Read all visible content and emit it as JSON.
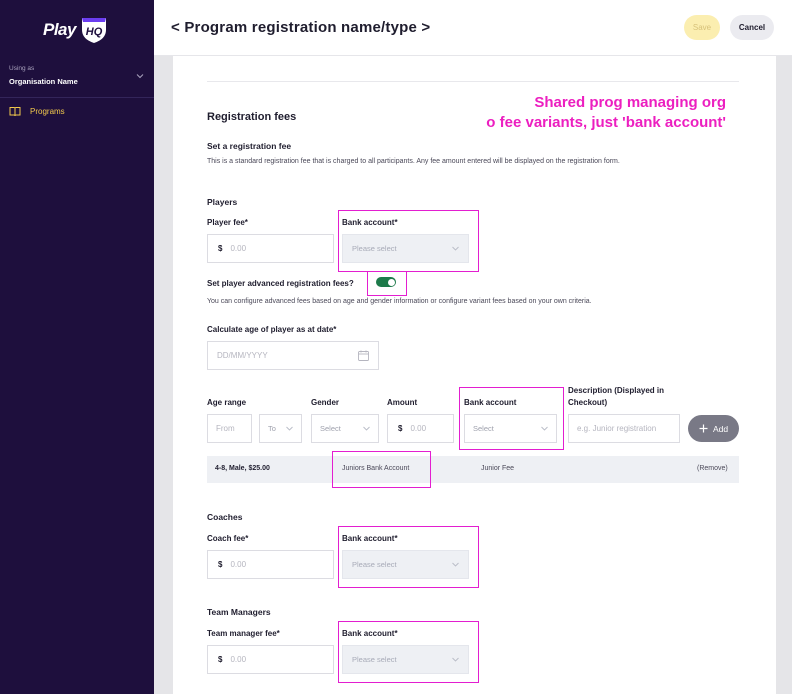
{
  "app": {
    "logo_text": "Play",
    "logo_badge_text": "HQ"
  },
  "sidebar": {
    "using_as": "Using as",
    "org_name": "Organisation Name",
    "items": [
      {
        "label": "Programs",
        "icon": "book-icon"
      }
    ]
  },
  "header": {
    "title": "< Program registration name/type >",
    "save_label": "Save",
    "cancel_label": "Cancel"
  },
  "annotation": {
    "line1": "Shared prog managing org",
    "line2": "o fee variants, just 'bank account'"
  },
  "registration": {
    "title": "Registration fees",
    "set_fee_title": "Set a registration fee",
    "set_fee_desc": "This is a standard registration fee that is charged to all participants. Any fee amount entered will be displayed on the registration form.",
    "players": {
      "title": "Players",
      "fee_label": "Player fee*",
      "currency": "$",
      "fee_placeholder": "0.00",
      "bank_label": "Bank account*",
      "bank_placeholder": "Please select",
      "advanced_label": "Set player advanced registration fees?",
      "advanced_enabled": true,
      "advanced_desc": "You can configure advanced fees based on age and gender information or configure variant fees based on your own criteria.",
      "age_date_label": "Calculate age of player as at date*",
      "age_date_placeholder": "DD/MM/YYYY"
    },
    "variants": {
      "col_age": "Age range",
      "col_gender": "Gender",
      "col_amount": "Amount",
      "col_bank": "Bank account",
      "col_desc": "Description (Displayed in Checkout)",
      "from_placeholder": "From",
      "to_placeholder": "To",
      "gender_placeholder": "Select",
      "amount_currency": "$",
      "amount_placeholder": "0.00",
      "bank_placeholder": "Select",
      "desc_placeholder": "e.g. Junior registration",
      "add_label": "Add",
      "rows": [
        {
          "summary": "4-8, Male, $25.00",
          "bank": "Juniors Bank Account",
          "desc": "Junior Fee",
          "remove": "(Remove)"
        }
      ]
    },
    "coaches": {
      "title": "Coaches",
      "fee_label": "Coach fee*",
      "currency": "$",
      "fee_placeholder": "0.00",
      "bank_label": "Bank account*",
      "bank_placeholder": "Please select"
    },
    "managers": {
      "title": "Team Managers",
      "fee_label": "Team manager fee*",
      "currency": "$",
      "fee_placeholder": "0.00",
      "bank_label": "Bank account*",
      "bank_placeholder": "Please select"
    }
  }
}
